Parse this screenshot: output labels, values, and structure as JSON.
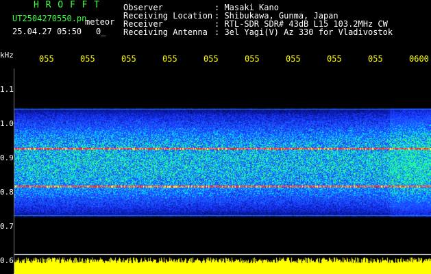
{
  "header": {
    "brand": "H R O F F T",
    "filename": "UT2504270550.pn",
    "meteor_label": "meteor",
    "datetime": "25.04.27 05:50",
    "counter": "0_",
    "fields": [
      {
        "label": "Observer",
        "value": ": Masaki Kano"
      },
      {
        "label": "Receiving Location",
        "value": ": Shibukawa, Gunma, Japan"
      },
      {
        "label": "Receiver",
        "value": ": RTL-SDR SDR# 43dB L15 103.2MHz CW"
      },
      {
        "label": "Receiving Antenna",
        "value": ": 3el Yagi(V) Az 330 for Vladivostok"
      }
    ]
  },
  "axis": {
    "unit": "kHz",
    "y_labels": [
      "1.1",
      "1.0",
      "0.9",
      "0.8",
      "0.7",
      "0.6"
    ],
    "x_labels": [
      "055",
      "055",
      "055",
      "055",
      "055",
      "055",
      "055",
      "055",
      "055",
      "0600"
    ]
  },
  "colors": {
    "background": "#000000",
    "header_green": "#3cff3c",
    "header_white": "#ffffff",
    "tick_yellow": "#ffff00",
    "signal_red": "#ff3030",
    "noise_blue": "#1a3cff",
    "band_yellow": "#ffff00"
  },
  "chart_data": {
    "type": "heatmap",
    "ylabel": "kHz",
    "ylim": [
      0.6,
      1.14
    ],
    "band_range_khz": [
      0.75,
      1.035
    ],
    "carrier_lines_khz": [
      0.93,
      0.83
    ]
  }
}
